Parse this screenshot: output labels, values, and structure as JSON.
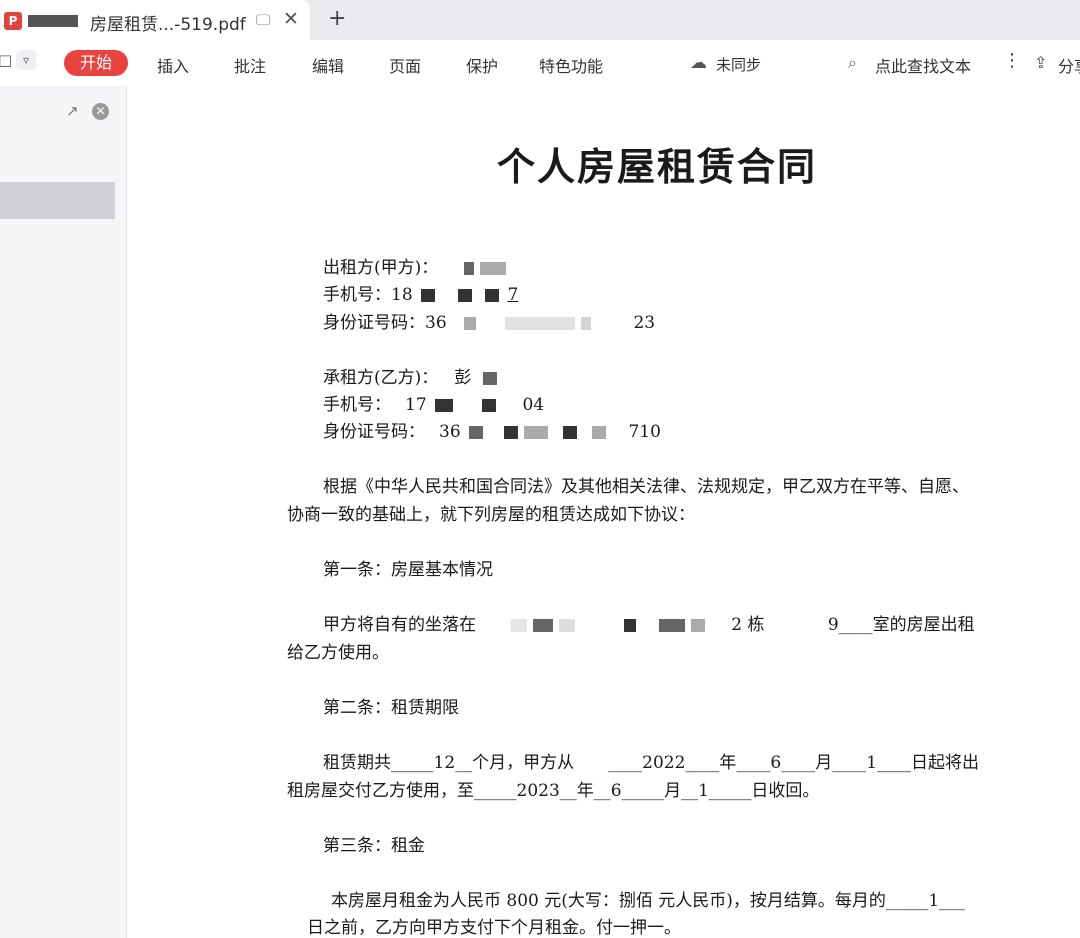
{
  "tab": {
    "title": "房屋租赁...-519.pdf"
  },
  "toolbar": {
    "start": "开始",
    "insert": "插入",
    "annotate": "批注",
    "edit": "编辑",
    "page": "页面",
    "protect": "保护",
    "features": "特色功能",
    "sync": "未同步",
    "search": "点此查找文本",
    "share": "分享"
  },
  "doc": {
    "title": "个人房屋租赁合同",
    "lessor_label": "出租方(甲方)：",
    "lessor_phone_label": "手机号：",
    "lessor_phone_start": "18",
    "lessor_phone_end": "7",
    "lessor_id_label": "身份证号码：",
    "lessor_id_start": "36",
    "lessor_id_end": "23",
    "lessee_label": "承租方(乙方)：",
    "lessee_name_start": "彭",
    "lessee_phone_label": "手机号：",
    "lessee_phone_start": "17",
    "lessee_phone_end": "04",
    "lessee_id_label": "身份证号码：",
    "lessee_id_start": "36",
    "lessee_id_end": "710",
    "intro_1": "根据《中华人民共和国合同法》及其他相关法律、法规规定，甲乙双方在平等、自愿、",
    "intro_2": "协商一致的基础上，就下列房屋的租赁达成如下协议：",
    "art1_title": "第一条：房屋基本情况",
    "art1_a": "甲方将自有的坐落在",
    "art1_b": "2 栋",
    "art1_c": "9____室的房屋出租",
    "art1_d": "给乙方使用。",
    "art2_title": "第二条：租赁期限",
    "art2_line1": "租赁期共_____12__个月，甲方从　　____2022____年____6____月____1____日起将出",
    "art2_line2": "租房屋交付乙方使用，至_____2023__年__6_____月__1_____日收回。",
    "art3_title": "第三条：租金",
    "art3_line1": "本房屋月租金为人民币 800 元(大写：捌佰 元人民币)，按月结算。每月的_____1___",
    "art3_line2": "日之前，乙方向甲方支付下个月租金。付一押一。"
  }
}
